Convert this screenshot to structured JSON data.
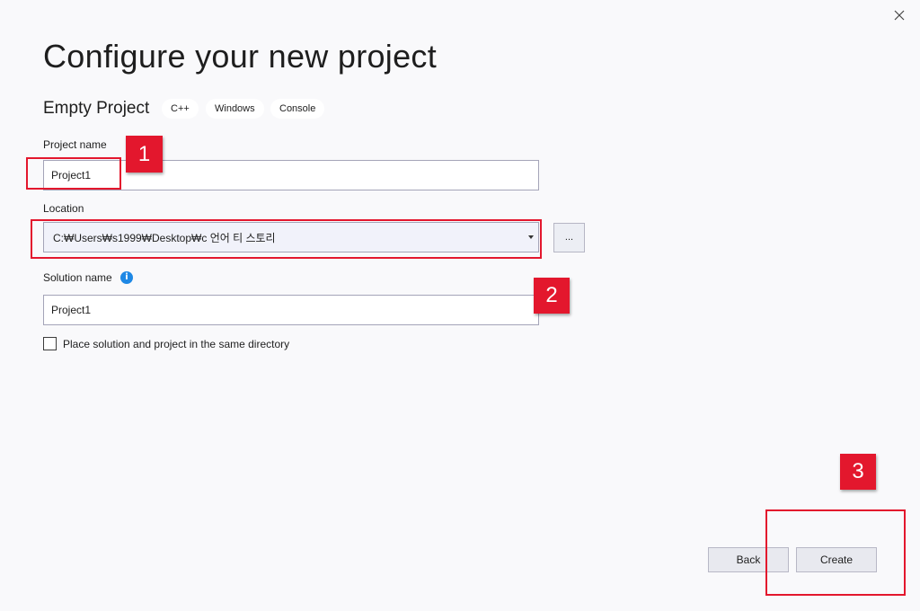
{
  "header": {
    "title": "Configure your new project",
    "close_icon": "close-icon"
  },
  "template": {
    "name": "Empty Project",
    "tags": [
      "C++",
      "Windows",
      "Console"
    ]
  },
  "form": {
    "project_name": {
      "label": "Project name",
      "value": "Project1"
    },
    "location": {
      "label": "Location",
      "value": "C:₩Users₩s1999₩Desktop₩c 언어 티 스토리",
      "browse_label": "..."
    },
    "solution_name": {
      "label": "Solution name",
      "value": "Project1",
      "info_icon": "info-icon",
      "info_glyph": "i"
    },
    "same_directory": {
      "label": "Place solution and project in the same directory",
      "checked": false
    }
  },
  "footer": {
    "back_label": "Back",
    "create_label": "Create"
  },
  "annotations": {
    "step1": "1",
    "step2": "2",
    "step3": "3",
    "color": "#e3172d"
  }
}
